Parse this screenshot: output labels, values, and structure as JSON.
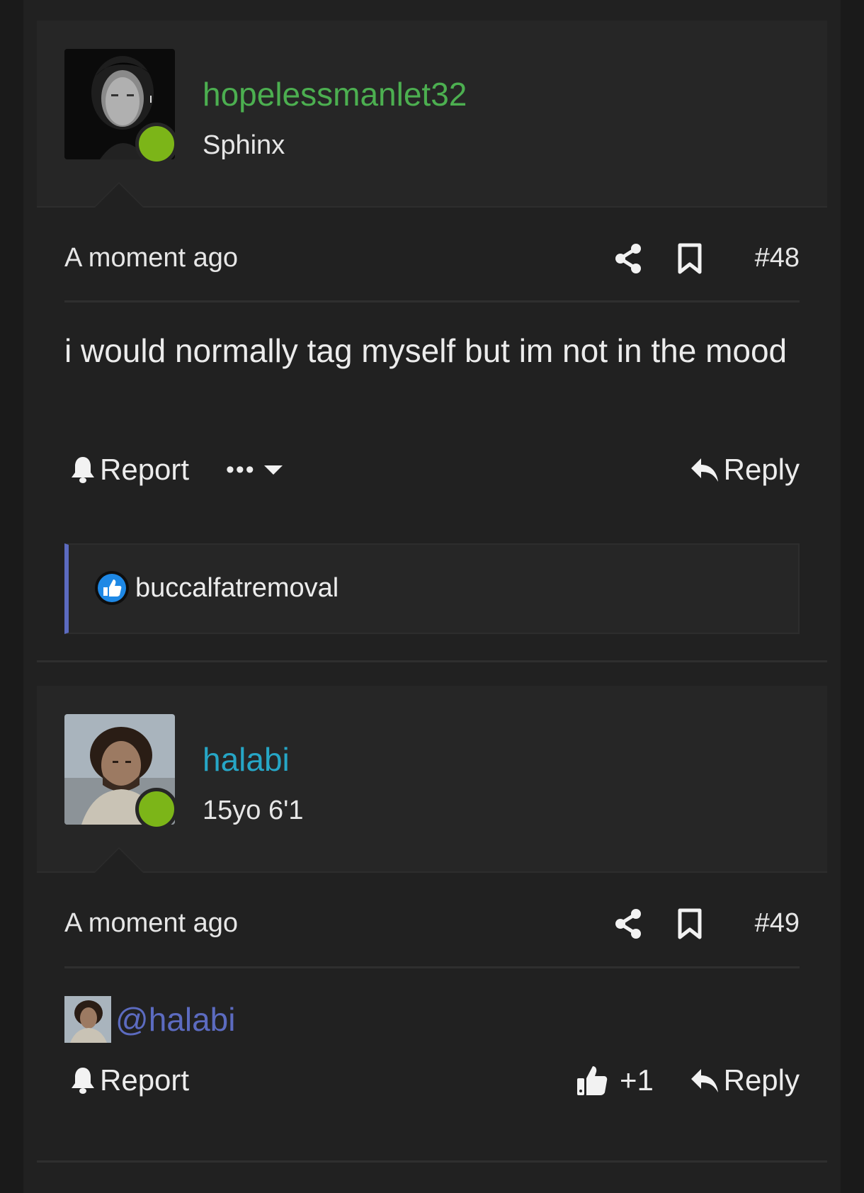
{
  "posts": [
    {
      "username": "hopelessmanlet32",
      "username_color": "#4caf50",
      "user_title": "Sphinx",
      "time": "A moment ago",
      "number": "#48",
      "content": "i would normally tag myself but im not in the mood",
      "report_label": "Report",
      "more_label": "•••",
      "reply_label": "Reply",
      "reaction": {
        "icon": "like-icon",
        "user": "buccalfatremoval"
      }
    },
    {
      "username": "halabi",
      "username_color": "#26a6c6",
      "user_title": "15yo 6'1",
      "time": "A moment ago",
      "number": "#49",
      "mention": "@halabi",
      "report_label": "Report",
      "like_count": "+1",
      "reply_label": "Reply"
    }
  ],
  "colors": {
    "online": "#7cb518",
    "mention": "#5c6bc0",
    "reaction_bar": "#5c6bc0"
  }
}
